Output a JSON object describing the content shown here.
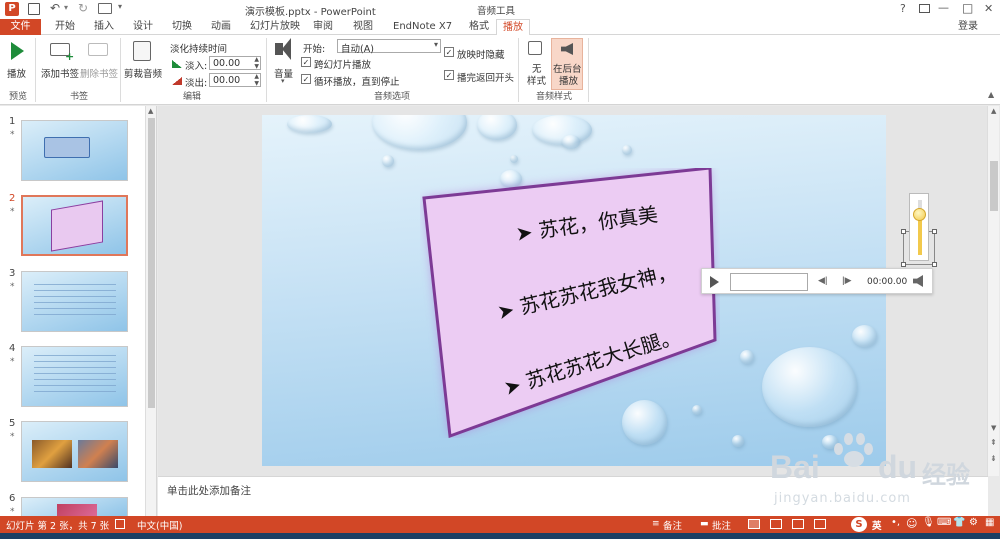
{
  "title": {
    "text": "演示模板.pptx - PowerPoint",
    "context_group": "音频工具",
    "help": "?",
    "minimize": "—",
    "restore": "□",
    "close": "✕"
  },
  "tabs": [
    {
      "label": "文件"
    },
    {
      "label": "开始"
    },
    {
      "label": "插入"
    },
    {
      "label": "设计"
    },
    {
      "label": "切换"
    },
    {
      "label": "动画"
    },
    {
      "label": "幻灯片放映"
    },
    {
      "label": "审阅"
    },
    {
      "label": "视图"
    },
    {
      "label": "EndNote X7"
    },
    {
      "label": "格式"
    },
    {
      "label": "播放"
    }
  ],
  "login": "登录",
  "ribbon": {
    "play_label": "播放",
    "add_bookmark_label": "添加书签",
    "remove_bookmark_label": "删除书签",
    "trim_label": "剪裁音频",
    "fade_duration_label": "淡化持续时间",
    "fade_in_label": "淡入:",
    "fade_in_value": "00.00",
    "fade_out_label": "淡出:",
    "fade_out_value": "00.00",
    "volume_label": "音量",
    "start_label": "开始:",
    "start_value": "自动(A)",
    "cross_slides_label": "跨幻灯片播放",
    "loop_label": "循环播放，直到停止",
    "hide_label": "放映时隐藏",
    "rewind_label": "播完返回开头",
    "no_style_line1": "无",
    "no_style_line2": "样式",
    "bg_play_line1": "在后台",
    "bg_play_line2": "播放",
    "group_preview": "预览",
    "group_bookmark": "书签",
    "group_edit": "编辑",
    "group_audio_options": "音频选项",
    "group_audio_styles": "音频样式"
  },
  "thumbnails": [
    {
      "number": "1",
      "star": "*"
    },
    {
      "number": "2",
      "star": "*"
    },
    {
      "number": "3",
      "star": "*"
    },
    {
      "number": "4",
      "star": "*"
    },
    {
      "number": "5",
      "star": "*"
    },
    {
      "number": "6",
      "star": "*"
    }
  ],
  "slide": {
    "line1": "苏花，你真美",
    "line2": "苏花苏花我女神，",
    "line3": "苏花苏花大长腿。",
    "bullet": "➤"
  },
  "player": {
    "time": "00:00.00"
  },
  "notes": {
    "placeholder": "单击此处添加备注"
  },
  "watermark": {
    "text1": "Bai",
    "text2": "du",
    "text3": "经验",
    "url": "jingyan.baidu.com"
  },
  "status": {
    "slide_info": "幻灯片 第 2 张，共 7 张",
    "language": "中文(中国)",
    "notes_btn": "备注",
    "comments_btn": "批注",
    "ime": "英"
  },
  "colors": {
    "accent": "#d24726",
    "slide_card": "#e9c9f0",
    "card_border": "#8a3fa0"
  }
}
